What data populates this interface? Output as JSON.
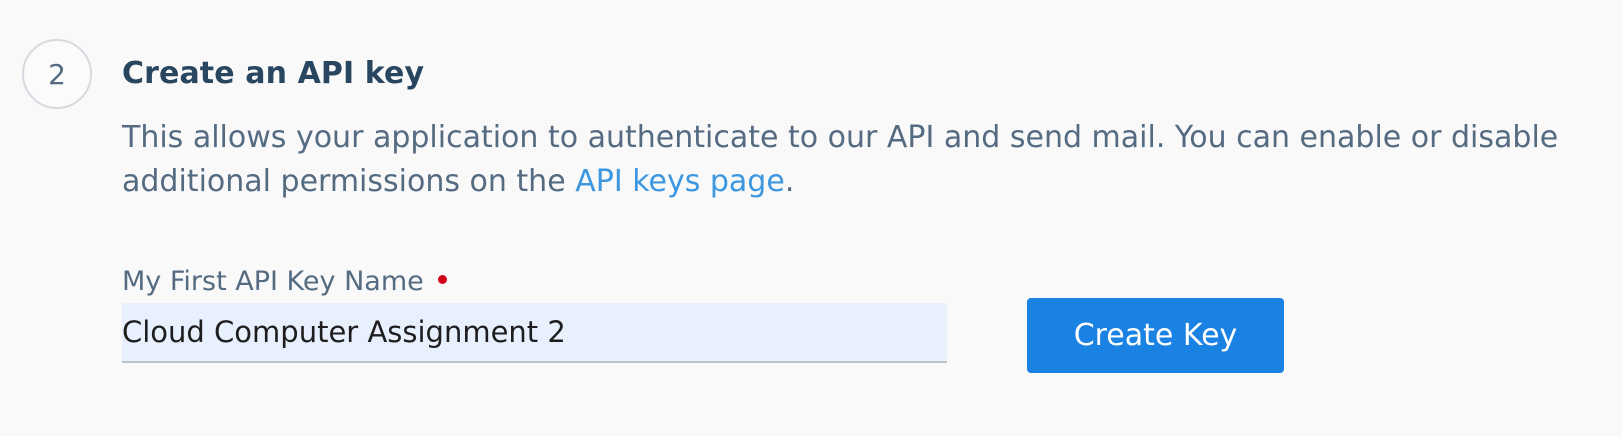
{
  "step": {
    "number": "2",
    "title": "Create an API key",
    "description_before_link": "This allows your application to authenticate to our API and send mail. You can enable or disable additional permissions on the ",
    "link_text": "API keys page",
    "description_after_link": "."
  },
  "form": {
    "label": "My First API Key Name",
    "input_value": "Cloud Computer Assignment 2",
    "required_color": "#d0021b",
    "submit_label": "Create Key"
  },
  "colors": {
    "accent": "#1a82e2",
    "link": "#3c97e0",
    "heading": "#294661",
    "body_text": "#546b81",
    "input_background": "#e8f0fe"
  }
}
